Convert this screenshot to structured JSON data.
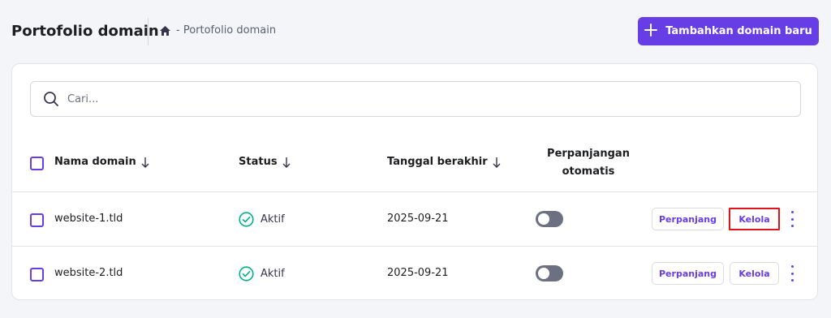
{
  "header": {
    "title": "Portofolio domain",
    "breadcrumb_text": "- Portofolio domain",
    "add_button_label": "Tambahkan domain baru"
  },
  "search": {
    "placeholder": "Cari..."
  },
  "table": {
    "columns": {
      "domain": "Nama domain",
      "status": "Status",
      "expiry": "Tanggal berakhir",
      "auto_renew_line1": "Perpanjangan",
      "auto_renew_line2": "otomatis"
    },
    "rows": [
      {
        "domain": "website-1.tld",
        "status": "Aktif",
        "expiry": "2025-09-21",
        "auto_renew": false,
        "renew_label": "Perpanjang",
        "manage_label": "Kelola"
      },
      {
        "domain": "website-2.tld",
        "status": "Aktif",
        "expiry": "2025-09-21",
        "auto_renew": false,
        "renew_label": "Perpanjang",
        "manage_label": "Kelola"
      }
    ]
  },
  "colors": {
    "accent": "#673de6",
    "status_ok": "#00b090",
    "highlight": "#e2141b",
    "toggle_off": "#6d7081"
  },
  "icons": [
    "home-icon",
    "plus-icon",
    "search-icon",
    "sort-arrow-icon",
    "check-circle-icon",
    "more-vertical-icon"
  ]
}
